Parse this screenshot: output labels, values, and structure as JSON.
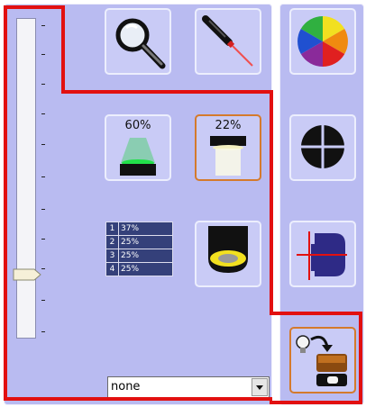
{
  "lights": {
    "spot_percent": "60%",
    "flood_percent": "22%"
  },
  "channels": [
    {
      "number": "1",
      "percent": "37%"
    },
    {
      "number": "2",
      "percent": "25%"
    },
    {
      "number": "3",
      "percent": "25%"
    },
    {
      "number": "4",
      "percent": "25%"
    }
  ],
  "dropdown": {
    "selected": "none"
  },
  "slider": {
    "level_fraction": 0.2
  },
  "colors": {
    "panel": "#b9bbf1",
    "highlight": "#e21010",
    "selected_border": "#d47a2c",
    "table_cell": "#34407a"
  }
}
